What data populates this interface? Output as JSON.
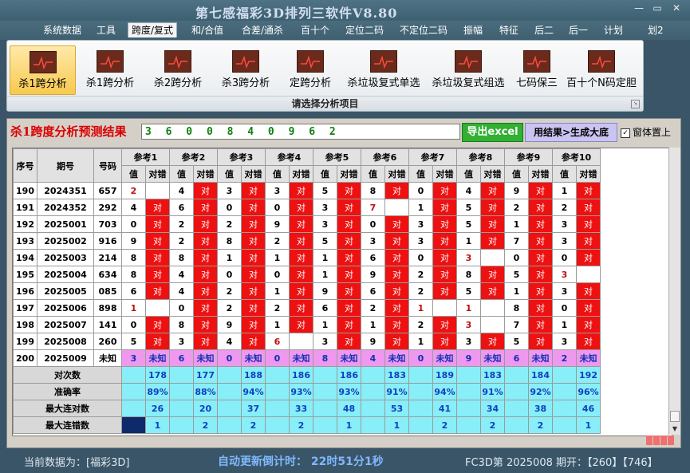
{
  "window": {
    "title": "第七感福彩3D排列三软件V8.80"
  },
  "menu": [
    "系统数据",
    "工具",
    "跨度/复式",
    "和/合值",
    "合差/通杀",
    "百十个",
    "定位二码",
    "不定位二码",
    "振幅",
    "特征",
    "后二",
    "后一",
    "计划",
    "划2"
  ],
  "ribbon": {
    "buttons": [
      "杀1跨分析",
      "杀1跨分析",
      "杀2跨分析",
      "杀3跨分析",
      "定跨分析",
      "杀垃圾复式单选",
      "杀垃圾复式组选",
      "七码保三",
      "百十个N码定胆"
    ],
    "group_label": "请选择分析项目"
  },
  "result": {
    "title": "杀1跨度分析预测结果",
    "value": "3 6 0 0 8 4 0 9 6 2",
    "export_button": "导出excel",
    "generate_button": "用结果>生成大底",
    "pin_label": "窗体置上"
  },
  "table": {
    "headers": {
      "seq": "序号",
      "period": "期号",
      "code": "号码",
      "refs": [
        "参考1",
        "参考2",
        "参考3",
        "参考4",
        "参考5",
        "参考6",
        "参考7",
        "参考8",
        "参考9",
        "参考10"
      ],
      "val": "值",
      "ok": "对错"
    },
    "rows": [
      {
        "seq": "190",
        "period": "2024351",
        "code": "657",
        "vals": [
          "2",
          "4",
          "3",
          "3",
          "5",
          "8",
          "0",
          "4",
          "9",
          "1"
        ],
        "ok": [
          "",
          "对",
          "对",
          "对",
          "对",
          "对",
          "对",
          "对",
          "对",
          "对"
        ]
      },
      {
        "seq": "191",
        "period": "2024352",
        "code": "292",
        "vals": [
          "4",
          "6",
          "0",
          "0",
          "3",
          "7",
          "1",
          "5",
          "2",
          "2"
        ],
        "ok": [
          "对",
          "对",
          "对",
          "对",
          "对",
          "",
          "对",
          "对",
          "对",
          "对"
        ]
      },
      {
        "seq": "192",
        "period": "2025001",
        "code": "703",
        "vals": [
          "0",
          "2",
          "2",
          "9",
          "3",
          "0",
          "3",
          "5",
          "1",
          "3"
        ],
        "ok": [
          "对",
          "对",
          "对",
          "对",
          "对",
          "对",
          "对",
          "对",
          "对",
          "对"
        ]
      },
      {
        "seq": "193",
        "period": "2025002",
        "code": "916",
        "vals": [
          "9",
          "2",
          "8",
          "2",
          "5",
          "3",
          "3",
          "1",
          "7",
          "3"
        ],
        "ok": [
          "对",
          "对",
          "对",
          "对",
          "对",
          "对",
          "对",
          "对",
          "对",
          "对"
        ]
      },
      {
        "seq": "194",
        "period": "2025003",
        "code": "214",
        "vals": [
          "8",
          "8",
          "1",
          "1",
          "1",
          "6",
          "0",
          "3",
          "0",
          "0"
        ],
        "ok": [
          "对",
          "对",
          "对",
          "对",
          "对",
          "对",
          "对",
          "",
          "对",
          "对"
        ]
      },
      {
        "seq": "195",
        "period": "2025004",
        "code": "634",
        "vals": [
          "8",
          "4",
          "0",
          "0",
          "1",
          "9",
          "2",
          "8",
          "5",
          "3"
        ],
        "ok": [
          "对",
          "对",
          "对",
          "对",
          "对",
          "对",
          "对",
          "对",
          "对",
          ""
        ]
      },
      {
        "seq": "196",
        "period": "2025005",
        "code": "085",
        "vals": [
          "6",
          "4",
          "2",
          "1",
          "9",
          "6",
          "2",
          "5",
          "1",
          "3"
        ],
        "ok": [
          "对",
          "对",
          "对",
          "对",
          "对",
          "对",
          "对",
          "对",
          "对",
          "对"
        ]
      },
      {
        "seq": "197",
        "period": "2025006",
        "code": "898",
        "vals": [
          "1",
          "0",
          "2",
          "2",
          "6",
          "2",
          "1",
          "1",
          "8",
          "0"
        ],
        "ok": [
          "",
          "对",
          "对",
          "对",
          "对",
          "对",
          "",
          "",
          "对",
          "对"
        ]
      },
      {
        "seq": "198",
        "period": "2025007",
        "code": "141",
        "vals": [
          "0",
          "8",
          "9",
          "1",
          "1",
          "1",
          "2",
          "3",
          "7",
          "1"
        ],
        "ok": [
          "对",
          "对",
          "对",
          "对",
          "对",
          "对",
          "对",
          "",
          "对",
          "对"
        ]
      },
      {
        "seq": "199",
        "period": "2025008",
        "code": "260",
        "vals": [
          "5",
          "3",
          "4",
          "6",
          "3",
          "9",
          "1",
          "3",
          "5",
          "3"
        ],
        "ok": [
          "对",
          "对",
          "对",
          "",
          "对",
          "对",
          "对",
          "对",
          "对",
          "对"
        ]
      },
      {
        "seq": "200",
        "period": "2025009",
        "code": "未知",
        "vals": [
          "3",
          "6",
          "0",
          "0",
          "8",
          "4",
          "0",
          "9",
          "6",
          "2"
        ],
        "ok": [
          "未知",
          "未知",
          "未知",
          "未知",
          "未知",
          "未知",
          "未知",
          "未知",
          "未知",
          "未知"
        ]
      }
    ],
    "stats": [
      {
        "label": "对次数",
        "values": [
          "178",
          "177",
          "188",
          "186",
          "186",
          "183",
          "189",
          "183",
          "184",
          "192"
        ]
      },
      {
        "label": "准确率",
        "values": [
          "89%",
          "88%",
          "94%",
          "93%",
          "93%",
          "91%",
          "94%",
          "91%",
          "92%",
          "96%"
        ]
      },
      {
        "label": "最大连对数",
        "values": [
          "26",
          "20",
          "37",
          "33",
          "48",
          "53",
          "41",
          "34",
          "38",
          "46"
        ]
      },
      {
        "label": "最大连错数",
        "values": [
          "1",
          "2",
          "2",
          "2",
          "1",
          "1",
          "2",
          "2",
          "2",
          "1"
        ]
      }
    ]
  },
  "status": {
    "current_data": "当前数据为：[福彩3D]",
    "countdown": "自动更新倒计时：  22时51分1秒",
    "draw_info": "FC3D第 2025008 期开：【260】【746】"
  }
}
